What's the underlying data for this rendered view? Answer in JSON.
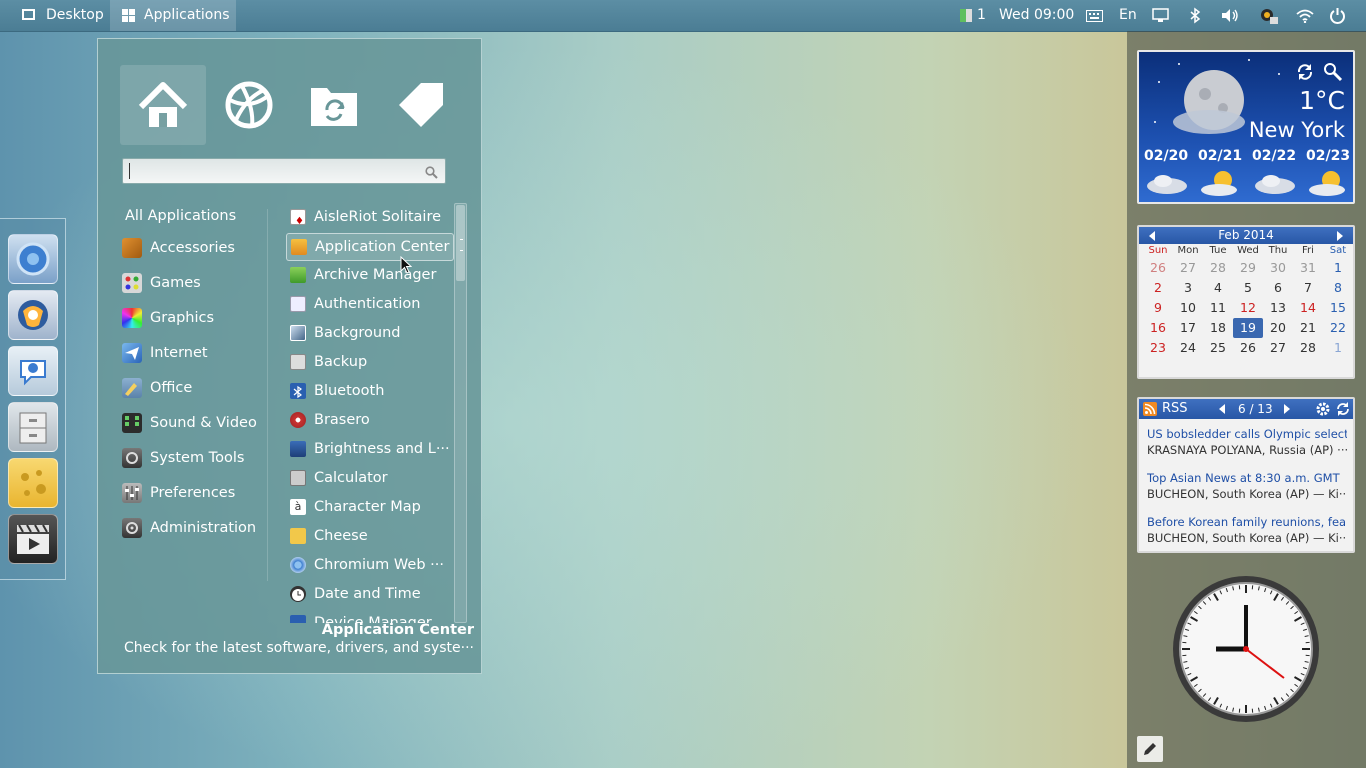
{
  "panel": {
    "desktop_label": "Desktop",
    "applications_label": "Applications",
    "workspace_count": "1",
    "clock": "Wed 09:00",
    "keyboard_layout": "En"
  },
  "menu": {
    "search_placeholder": "",
    "categories": [
      {
        "label": "All Applications"
      },
      {
        "label": "Accessories"
      },
      {
        "label": "Games"
      },
      {
        "label": "Graphics"
      },
      {
        "label": "Internet"
      },
      {
        "label": "Office"
      },
      {
        "label": "Sound & Video"
      },
      {
        "label": "System Tools"
      },
      {
        "label": "Preferences"
      },
      {
        "label": "Administration"
      }
    ],
    "apps": [
      {
        "label": "AisleRiot Solitaire"
      },
      {
        "label": "Application Center"
      },
      {
        "label": "Archive Manager"
      },
      {
        "label": "Authentication"
      },
      {
        "label": "Background"
      },
      {
        "label": "Backup"
      },
      {
        "label": "Bluetooth"
      },
      {
        "label": "Brasero"
      },
      {
        "label": "Brightness and L···"
      },
      {
        "label": "Calculator"
      },
      {
        "label": "Character Map"
      },
      {
        "label": "Cheese"
      },
      {
        "label": "Chromium Web ···"
      },
      {
        "label": "Date and Time"
      },
      {
        "label": "Device Manager"
      }
    ],
    "selected_app": "Application Center",
    "description_title": "Application Center",
    "description_text": "Check for the latest software, drivers, and syste···"
  },
  "weather": {
    "temperature": "1°C",
    "city": "New York",
    "days": [
      "02/20",
      "02/21",
      "02/22",
      "02/23"
    ]
  },
  "calendar": {
    "month_label": "Feb 2014",
    "weekdays": [
      "Sun",
      "Mon",
      "Tue",
      "Wed",
      "Thu",
      "Fri",
      "Sat"
    ],
    "weeks": [
      [
        "26",
        "27",
        "28",
        "29",
        "30",
        "31",
        "1"
      ],
      [
        "2",
        "3",
        "4",
        "5",
        "6",
        "7",
        "8"
      ],
      [
        "9",
        "10",
        "11",
        "12",
        "13",
        "14",
        "15"
      ],
      [
        "16",
        "17",
        "18",
        "19",
        "20",
        "21",
        "22"
      ],
      [
        "23",
        "24",
        "25",
        "26",
        "27",
        "28",
        "1"
      ]
    ],
    "today": "19"
  },
  "rss": {
    "title": "RSS",
    "pager": "6 / 13",
    "items": [
      {
        "title": "US bobsledder calls Olympic select···",
        "desc": "KRASNAYA POLYANA, Russia (AP) ···"
      },
      {
        "title": "Top Asian News at 8:30 a.m. GMT",
        "desc": "BUCHEON, South Korea (AP) — Ki···"
      },
      {
        "title": "Before Korean family reunions, fea···",
        "desc": "BUCHEON, South Korea (AP) — Ki···"
      }
    ]
  },
  "icons": [
    "desktop-icon",
    "applications-icon",
    "workspace-icon",
    "keyboard-icon",
    "display-icon",
    "bluetooth-icon",
    "volume-icon",
    "network-manager-icon",
    "wifi-icon",
    "power-icon",
    "home-icon",
    "globe-icon",
    "folder-sync-icon",
    "tag-icon",
    "search-icon",
    "chromium-icon",
    "mail-icon",
    "chat-icon",
    "file-cabinet-icon",
    "cheese-icon",
    "video-player-icon",
    "refresh-icon",
    "pen-icon"
  ]
}
